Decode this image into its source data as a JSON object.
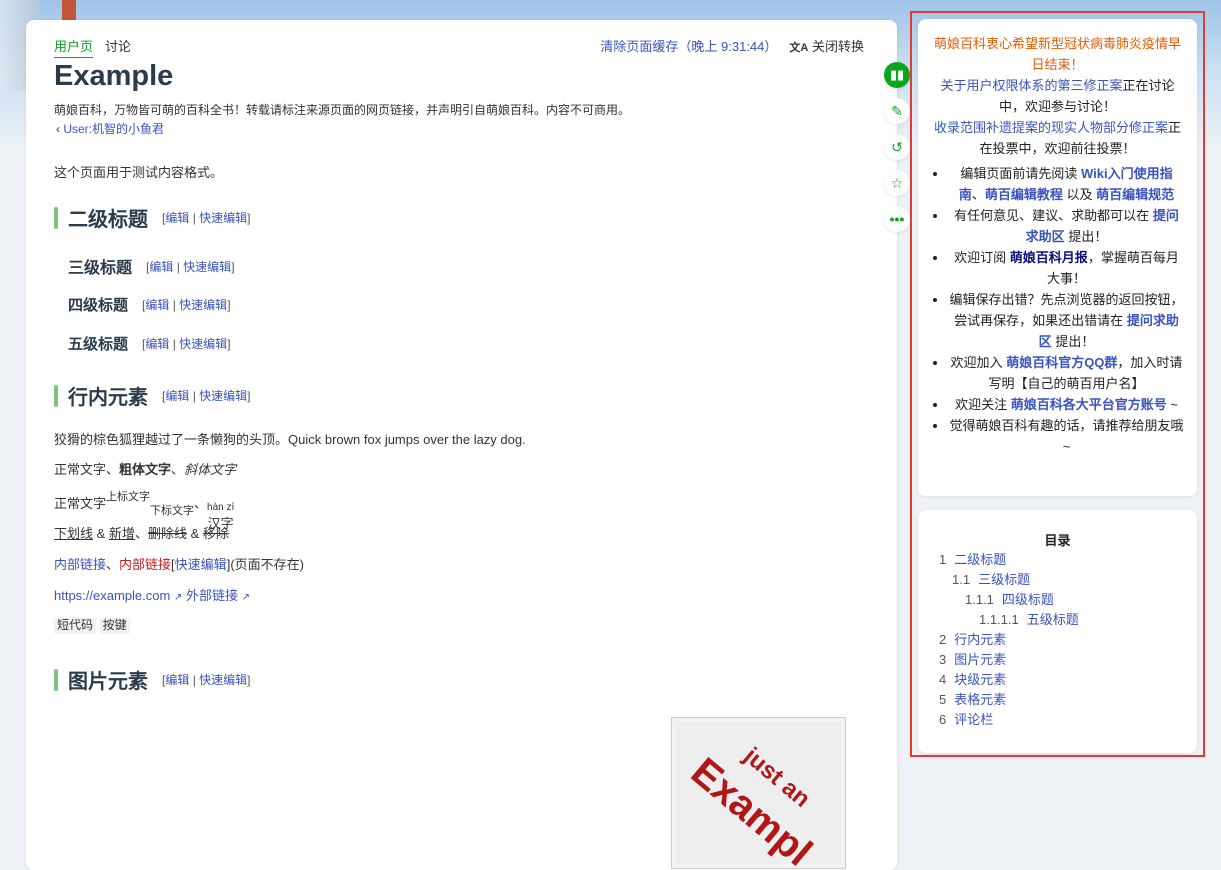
{
  "header": {
    "tab_user": "用户页",
    "tab_talk": "讨论",
    "purge": "清除页面缓存（晚上 9:31:44）",
    "convert": "关闭转换"
  },
  "page": {
    "title": "Example",
    "tagline": "萌娘百科，万物皆可萌的百科全书！转载请标注来源页面的网页链接，并声明引自萌娘百科。内容不可商用。",
    "back_link": "User:机智的小鱼君",
    "intro": "这个页面用于测试内容格式。"
  },
  "sections": {
    "h2": "二级标题",
    "h3": "三级标题",
    "h4": "四级标题",
    "h5": "五级标题",
    "inline": "行内元素",
    "images": "图片元素",
    "edit": "编辑",
    "quick_edit": "快速编辑"
  },
  "inline": {
    "line1": "狡猾的棕色狐狸越过了一条懒狗的头顶。Quick brown fox jumps over the lazy dog.",
    "normal": "正常文字",
    "bold": "粗体文字",
    "italic": "斜体文字",
    "sup": "上标文字",
    "sub": "下标文字",
    "ruby_top": "hàn zì",
    "ruby_base": "汉字",
    "underline": "下划线",
    "insert": "新增",
    "strike": "删除线",
    "del": "移除",
    "internal_link": "内部链接",
    "red_link": "内部链接",
    "quick_edit_link": "快速编辑",
    "nonexist": "(页面不存在)",
    "ext_url": "https://example.com",
    "ext_link": "外部链接",
    "code": "短代码",
    "kbd": "按键"
  },
  "image": {
    "text1": "just an",
    "text2": "Exampl"
  },
  "notice": {
    "l1": "萌娘百科衷心希望新型冠状病毒肺炎疫情早日结束！",
    "l2a": "关于用户权限体系的第三修正案",
    "l2b": "正在讨论中，欢迎参与讨论！",
    "l3a": "收录范围补遗提案的现实人物部分修正案",
    "l3b": "正在投票中，欢迎前往投票！",
    "b1": "编辑页面前请先阅读",
    "b1l1": "Wiki入门使用指南",
    "b1l2": "萌百编辑教程",
    "b1m": "以及",
    "b1l3": "萌百编辑规范",
    "b2": "有任何意见、建议、求助都可以在",
    "b2l": "提问求助区",
    "b2e": "提出！",
    "b3a": "欢迎订阅",
    "b3l": "萌娘百科月报",
    "b3e": "，掌握萌百每月大事！",
    "b4": "编辑保存出错？先点浏览器的返回按钮，尝试再保存，如果还出错请在",
    "b4l": "提问求助区",
    "b4e": "提出！",
    "b5a": "欢迎加入",
    "b5l": "萌娘百科官方QQ群",
    "b5e": "，加入时请写明【自己的萌百用户名】",
    "b6a": "欢迎关注",
    "b6l": "萌娘百科各大平台官方账号",
    "b6e": "~",
    "b7": "觉得萌娘百科有趣的话，请推荐给朋友哦~"
  },
  "toc": {
    "title": "目录",
    "items": [
      {
        "num": "1",
        "label": "二级标题"
      },
      {
        "num": "1.1",
        "label": "三级标题"
      },
      {
        "num": "1.1.1",
        "label": "四级标题"
      },
      {
        "num": "1.1.1.1",
        "label": "五级标题"
      },
      {
        "num": "2",
        "label": "行内元素"
      },
      {
        "num": "3",
        "label": "图片元素"
      },
      {
        "num": "4",
        "label": "块级元素"
      },
      {
        "num": "5",
        "label": "表格元素"
      },
      {
        "num": "6",
        "label": "评论栏"
      }
    ]
  },
  "colors": {
    "accent_green": "#0ba51f",
    "link": "#3a53c0",
    "red_link": "#c81e1e",
    "notice_orange": "#e65c00"
  }
}
